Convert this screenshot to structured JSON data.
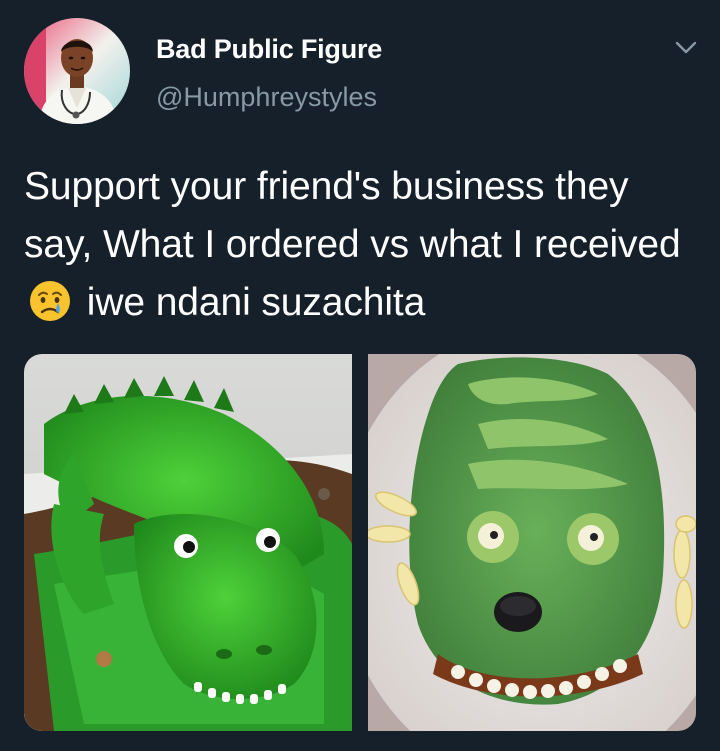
{
  "author": {
    "name": "Bad Public Figure",
    "handle": "@Humphreystyles",
    "avatar_icon": "profile-photo"
  },
  "menu": {
    "icon": "chevron-down-icon"
  },
  "tweet": {
    "text_before_emoji": "Support your friend's business they say, What I ordered vs what I received",
    "emoji": "crying-face",
    "text_after_emoji": "iwe ndani suzachita"
  },
  "media": [
    {
      "description_icon": "crocodile-cake-ordered-photo"
    },
    {
      "description_icon": "crocodile-cake-received-photo"
    }
  ],
  "colors": {
    "background": "#15202b",
    "primary_text": "#ffffff",
    "secondary_text": "#8899a6"
  }
}
